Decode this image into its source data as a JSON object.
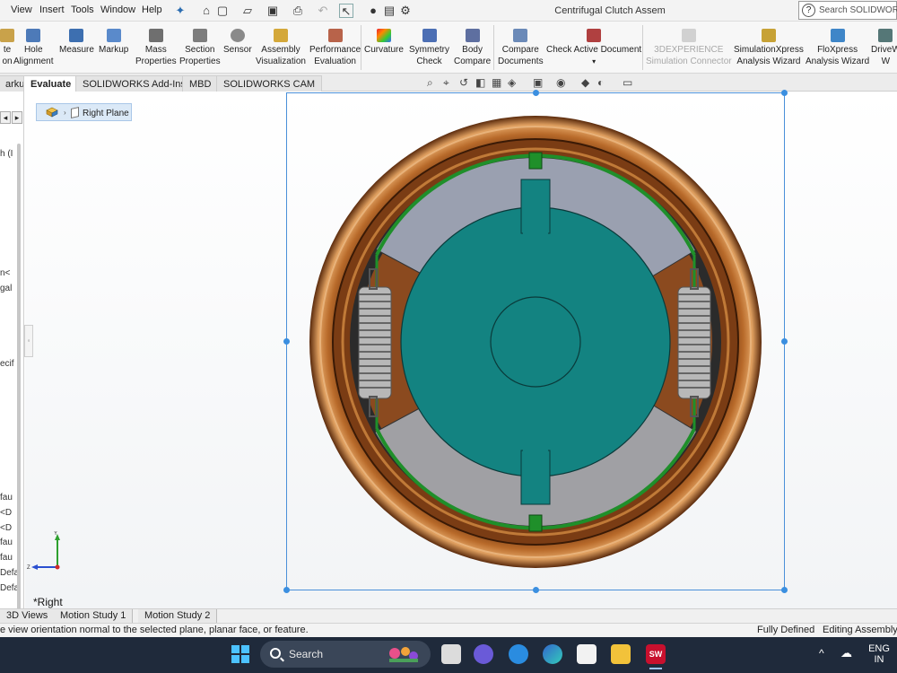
{
  "menubar": {
    "items": [
      "View",
      "Insert",
      "Tools",
      "Window",
      "Help"
    ],
    "window_title": "Centrifugal Clutch Assem",
    "search_placeholder": "Search SOLIDWORKS"
  },
  "ribbon": {
    "partial_first": {
      "line1": "te",
      "line2": "on"
    },
    "buttons": [
      {
        "line1": "Hole",
        "line2": "Alignment"
      },
      {
        "line1": "Measure",
        "line2": ""
      },
      {
        "line1": "Markup",
        "line2": ""
      },
      {
        "line1": "Mass",
        "line2": "Properties"
      },
      {
        "line1": "Section",
        "line2": "Properties"
      },
      {
        "line1": "Sensor",
        "line2": ""
      },
      {
        "line1": "Assembly",
        "line2": "Visualization"
      },
      {
        "line1": "Performance",
        "line2": "Evaluation"
      },
      {
        "line1": "Curvature",
        "line2": ""
      },
      {
        "line1": "Symmetry",
        "line2": "Check"
      },
      {
        "line1": "Body",
        "line2": "Compare"
      },
      {
        "line1": "Compare",
        "line2": "Documents"
      },
      {
        "line1": "Check Active Document",
        "line2": ""
      },
      {
        "line1": "3DEXPERIENCE",
        "line2": "Simulation Connector"
      },
      {
        "line1": "SimulationXpress",
        "line2": "Analysis Wizard"
      },
      {
        "line1": "FloXpress",
        "line2": "Analysis Wizard"
      },
      {
        "line1": "DriveW",
        "line2": "W"
      }
    ]
  },
  "tabs": [
    "arkup",
    "Evaluate",
    "SOLIDWORKS Add-Ins",
    "MBD",
    "SOLIDWORKS CAM"
  ],
  "active_tab": "Evaluate",
  "feature_tree": {
    "fragments": [
      "h (I",
      "n<",
      "gal",
      "ecif",
      "fau",
      "<D",
      "<D",
      "fau",
      "fau",
      "Defa",
      "Defa"
    ]
  },
  "viewport": {
    "selected_feature": "Right Plane",
    "view_label": "*Right",
    "colors": {
      "drum_copper": "#8a4a1e",
      "lining_dark": "#2b2b2b",
      "shoe_green": "#1f8f2a",
      "hub_teal": "#138381",
      "shoe_grey": "#9aa0b0"
    }
  },
  "bottom_tabs": [
    "3D Views",
    "Motion Study 1",
    "Motion Study 2"
  ],
  "status": {
    "message": "e view orientation normal to the selected plane, planar face, or feature.",
    "state": "Fully Defined",
    "mode": "Editing Assembly"
  },
  "taskbar": {
    "search_label": "Search",
    "lang_line1": "ENG",
    "lang_line2": "IN"
  }
}
